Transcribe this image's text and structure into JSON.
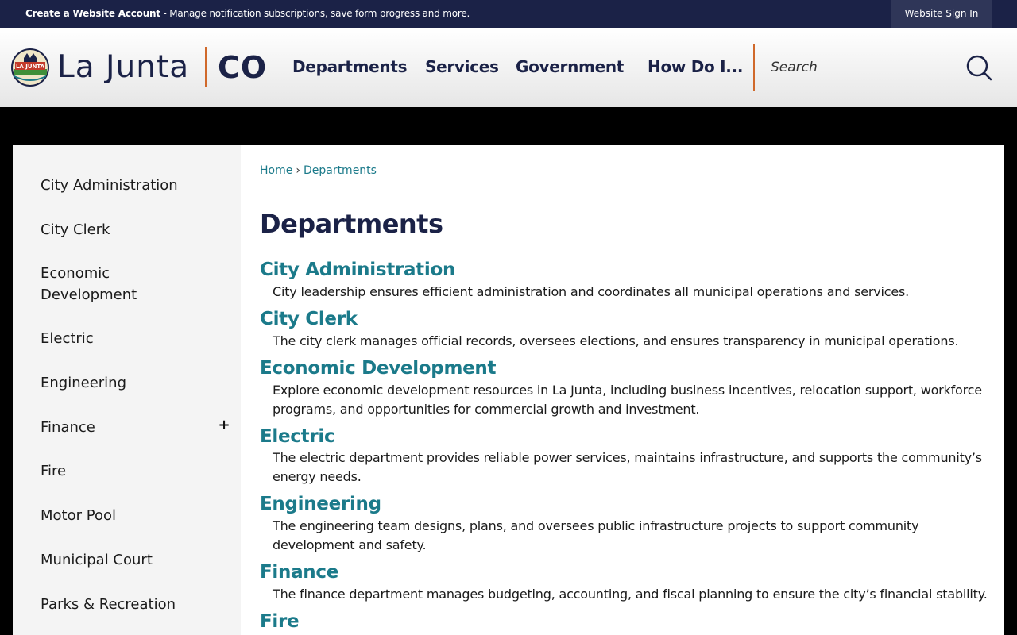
{
  "topbar": {
    "account_link": "Create a Website Account",
    "account_message": " - Manage notification subscriptions, save form progress and more.",
    "signin_label": "Website Sign In"
  },
  "header": {
    "logo_name": "La Junta",
    "logo_state": "CO",
    "seal_text": "LA JUNTA",
    "nav": [
      {
        "label": "Departments"
      },
      {
        "label": "Services"
      },
      {
        "label": "Government"
      },
      {
        "label": "How Do I..."
      }
    ],
    "search": {
      "placeholder": "Search",
      "icon": "search-icon"
    }
  },
  "sidebar": {
    "items": [
      {
        "label": "City Administration"
      },
      {
        "label": "City Clerk"
      },
      {
        "label": "Economic Development"
      },
      {
        "label": "Electric"
      },
      {
        "label": "Engineering"
      },
      {
        "label": "Finance",
        "expand": "+"
      },
      {
        "label": "Fire"
      },
      {
        "label": "Motor Pool"
      },
      {
        "label": "Municipal Court"
      },
      {
        "label": "Parks & Recreation"
      }
    ]
  },
  "breadcrumb": [
    {
      "label": "Home"
    },
    {
      "label": "Departments"
    }
  ],
  "breadcrumb_separator": "›",
  "page_title": "Departments",
  "departments": [
    {
      "title": "City Administration",
      "description": "City leadership ensures efficient administration and coordinates all municipal operations and services."
    },
    {
      "title": "City Clerk",
      "description": "The city clerk manages official records, oversees elections, and ensures transparency in municipal operations."
    },
    {
      "title": "Economic Development",
      "description": "Explore economic development resources in La Junta, including business incentives, relocation support, workforce programs, and opportunities for commercial growth and investment."
    },
    {
      "title": "Electric",
      "description": "The electric department provides reliable power services, maintains infrastructure, and supports the community’s energy needs."
    },
    {
      "title": "Engineering",
      "description": "The engineering team designs, plans, and oversees public infrastructure projects to support community development and safety."
    },
    {
      "title": "Finance",
      "description": "The finance department manages budgeting, accounting, and fiscal planning to ensure the city’s financial stability."
    },
    {
      "title": "Fire",
      "description": ""
    }
  ],
  "colors": {
    "navy": "#1b2247",
    "teal": "#1b7a8a",
    "orange": "#d0692b"
  }
}
